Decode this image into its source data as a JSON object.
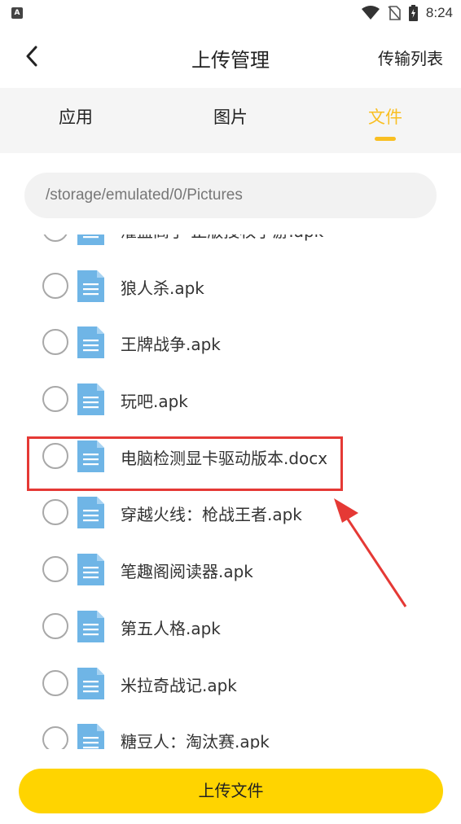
{
  "status_bar": {
    "time": "8:24",
    "app_badge": "A",
    "icons": [
      "wifi-icon",
      "no-sim-icon",
      "battery-charging-icon"
    ]
  },
  "header": {
    "back_icon": "chevron-left-icon",
    "title": "上传管理",
    "transfer_list": "传输列表"
  },
  "tabs": [
    {
      "label": "应用",
      "active": false
    },
    {
      "label": "图片",
      "active": false
    },
    {
      "label": "文件",
      "active": true
    }
  ],
  "accent_color": "#f9bf22",
  "path": "/storage/emulated/0/Pictures",
  "files": [
    {
      "name": "灌篮高手 正版授权手游.apk",
      "checked": false
    },
    {
      "name": "狼人杀.apk",
      "checked": false
    },
    {
      "name": "王牌战争.apk",
      "checked": false
    },
    {
      "name": "玩吧.apk",
      "checked": false
    },
    {
      "name": "电脑检测显卡驱动版本.docx",
      "checked": false,
      "highlighted": true
    },
    {
      "name": "穿越火线：枪战王者.apk",
      "checked": false
    },
    {
      "name": "笔趣阁阅读器.apk",
      "checked": false
    },
    {
      "name": "第五人格.apk",
      "checked": false
    },
    {
      "name": "米拉奇战记.apk",
      "checked": false
    },
    {
      "name": "糖豆人：淘汰赛.apk",
      "checked": false
    }
  ],
  "file_icon": "document-icon",
  "file_icon_color": "#6fb5e6",
  "annotation_color": "#e53935",
  "upload_button": "上传文件",
  "upload_button_color": "#ffd400"
}
